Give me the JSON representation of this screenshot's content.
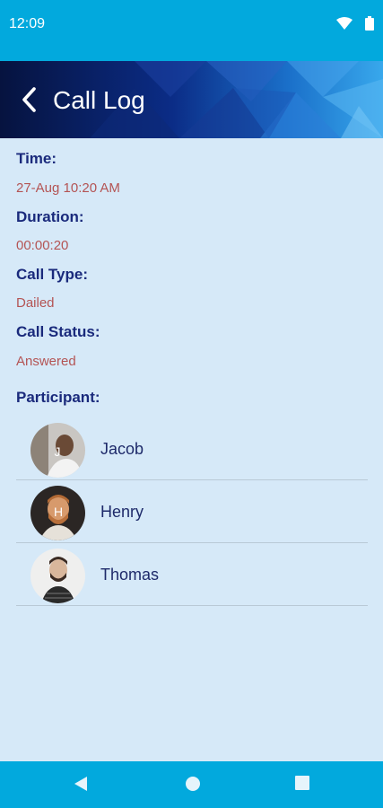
{
  "status_bar": {
    "time": "12:09",
    "icons": [
      "wifi-icon",
      "battery-icon"
    ]
  },
  "app_bar": {
    "title": "Call Log",
    "back_icon": "chevron-left-icon"
  },
  "details": {
    "time_label": "Time:",
    "time_value": "27-Aug 10:20 AM",
    "duration_label": "Duration:",
    "duration_value": "00:00:20",
    "call_type_label": "Call Type:",
    "call_type_value": "Dailed",
    "call_status_label": "Call Status:",
    "call_status_value": "Answered",
    "participant_label": "Participant:"
  },
  "participants": [
    {
      "name": "Jacob",
      "avatar_initial": "J"
    },
    {
      "name": "Henry",
      "avatar_initial": "H"
    },
    {
      "name": "Thomas",
      "avatar_initial": ""
    }
  ],
  "nav_bar": {
    "icons": [
      "back-triangle-icon",
      "home-circle-icon",
      "recents-square-icon"
    ]
  },
  "colors": {
    "status_bar": "#02a9dd",
    "background": "#d6e9f8",
    "label": "#1a2a7c",
    "value": "#b45454"
  }
}
